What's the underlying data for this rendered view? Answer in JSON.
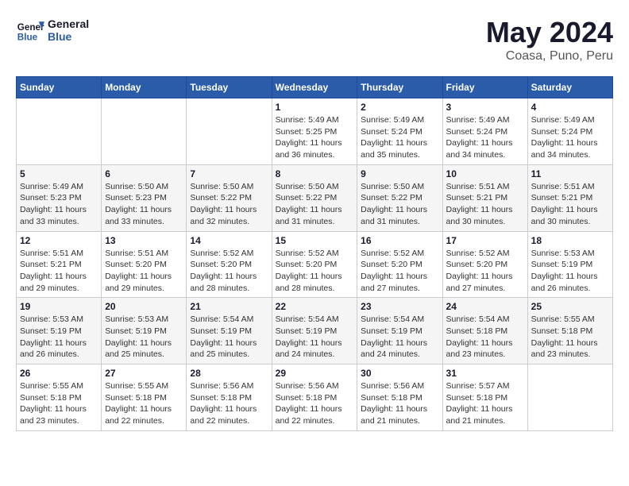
{
  "header": {
    "logo_line1": "General",
    "logo_line2": "Blue",
    "main_title": "May 2024",
    "subtitle": "Coasa, Puno, Peru"
  },
  "calendar": {
    "days_of_week": [
      "Sunday",
      "Monday",
      "Tuesday",
      "Wednesday",
      "Thursday",
      "Friday",
      "Saturday"
    ],
    "weeks": [
      [
        {
          "num": "",
          "info": ""
        },
        {
          "num": "",
          "info": ""
        },
        {
          "num": "",
          "info": ""
        },
        {
          "num": "1",
          "info": "Sunrise: 5:49 AM\nSunset: 5:25 PM\nDaylight: 11 hours\nand 36 minutes."
        },
        {
          "num": "2",
          "info": "Sunrise: 5:49 AM\nSunset: 5:24 PM\nDaylight: 11 hours\nand 35 minutes."
        },
        {
          "num": "3",
          "info": "Sunrise: 5:49 AM\nSunset: 5:24 PM\nDaylight: 11 hours\nand 34 minutes."
        },
        {
          "num": "4",
          "info": "Sunrise: 5:49 AM\nSunset: 5:24 PM\nDaylight: 11 hours\nand 34 minutes."
        }
      ],
      [
        {
          "num": "5",
          "info": "Sunrise: 5:49 AM\nSunset: 5:23 PM\nDaylight: 11 hours\nand 33 minutes."
        },
        {
          "num": "6",
          "info": "Sunrise: 5:50 AM\nSunset: 5:23 PM\nDaylight: 11 hours\nand 33 minutes."
        },
        {
          "num": "7",
          "info": "Sunrise: 5:50 AM\nSunset: 5:22 PM\nDaylight: 11 hours\nand 32 minutes."
        },
        {
          "num": "8",
          "info": "Sunrise: 5:50 AM\nSunset: 5:22 PM\nDaylight: 11 hours\nand 31 minutes."
        },
        {
          "num": "9",
          "info": "Sunrise: 5:50 AM\nSunset: 5:22 PM\nDaylight: 11 hours\nand 31 minutes."
        },
        {
          "num": "10",
          "info": "Sunrise: 5:51 AM\nSunset: 5:21 PM\nDaylight: 11 hours\nand 30 minutes."
        },
        {
          "num": "11",
          "info": "Sunrise: 5:51 AM\nSunset: 5:21 PM\nDaylight: 11 hours\nand 30 minutes."
        }
      ],
      [
        {
          "num": "12",
          "info": "Sunrise: 5:51 AM\nSunset: 5:21 PM\nDaylight: 11 hours\nand 29 minutes."
        },
        {
          "num": "13",
          "info": "Sunrise: 5:51 AM\nSunset: 5:20 PM\nDaylight: 11 hours\nand 29 minutes."
        },
        {
          "num": "14",
          "info": "Sunrise: 5:52 AM\nSunset: 5:20 PM\nDaylight: 11 hours\nand 28 minutes."
        },
        {
          "num": "15",
          "info": "Sunrise: 5:52 AM\nSunset: 5:20 PM\nDaylight: 11 hours\nand 28 minutes."
        },
        {
          "num": "16",
          "info": "Sunrise: 5:52 AM\nSunset: 5:20 PM\nDaylight: 11 hours\nand 27 minutes."
        },
        {
          "num": "17",
          "info": "Sunrise: 5:52 AM\nSunset: 5:20 PM\nDaylight: 11 hours\nand 27 minutes."
        },
        {
          "num": "18",
          "info": "Sunrise: 5:53 AM\nSunset: 5:19 PM\nDaylight: 11 hours\nand 26 minutes."
        }
      ],
      [
        {
          "num": "19",
          "info": "Sunrise: 5:53 AM\nSunset: 5:19 PM\nDaylight: 11 hours\nand 26 minutes."
        },
        {
          "num": "20",
          "info": "Sunrise: 5:53 AM\nSunset: 5:19 PM\nDaylight: 11 hours\nand 25 minutes."
        },
        {
          "num": "21",
          "info": "Sunrise: 5:54 AM\nSunset: 5:19 PM\nDaylight: 11 hours\nand 25 minutes."
        },
        {
          "num": "22",
          "info": "Sunrise: 5:54 AM\nSunset: 5:19 PM\nDaylight: 11 hours\nand 24 minutes."
        },
        {
          "num": "23",
          "info": "Sunrise: 5:54 AM\nSunset: 5:19 PM\nDaylight: 11 hours\nand 24 minutes."
        },
        {
          "num": "24",
          "info": "Sunrise: 5:54 AM\nSunset: 5:18 PM\nDaylight: 11 hours\nand 23 minutes."
        },
        {
          "num": "25",
          "info": "Sunrise: 5:55 AM\nSunset: 5:18 PM\nDaylight: 11 hours\nand 23 minutes."
        }
      ],
      [
        {
          "num": "26",
          "info": "Sunrise: 5:55 AM\nSunset: 5:18 PM\nDaylight: 11 hours\nand 23 minutes."
        },
        {
          "num": "27",
          "info": "Sunrise: 5:55 AM\nSunset: 5:18 PM\nDaylight: 11 hours\nand 22 minutes."
        },
        {
          "num": "28",
          "info": "Sunrise: 5:56 AM\nSunset: 5:18 PM\nDaylight: 11 hours\nand 22 minutes."
        },
        {
          "num": "29",
          "info": "Sunrise: 5:56 AM\nSunset: 5:18 PM\nDaylight: 11 hours\nand 22 minutes."
        },
        {
          "num": "30",
          "info": "Sunrise: 5:56 AM\nSunset: 5:18 PM\nDaylight: 11 hours\nand 21 minutes."
        },
        {
          "num": "31",
          "info": "Sunrise: 5:57 AM\nSunset: 5:18 PM\nDaylight: 11 hours\nand 21 minutes."
        },
        {
          "num": "",
          "info": ""
        }
      ]
    ]
  }
}
